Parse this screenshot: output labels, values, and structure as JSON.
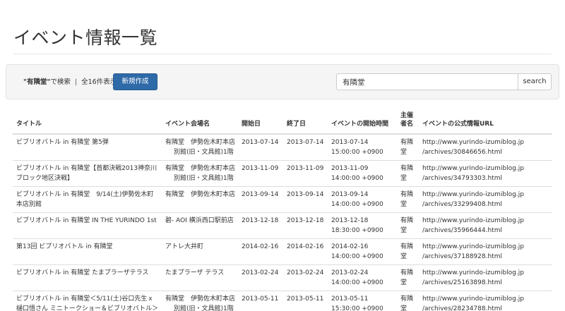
{
  "page": {
    "title": "イベント情報一覧"
  },
  "search_bar": {
    "query_display": "\"有隣堂\"",
    "query_suffix": "で検索",
    "separator": "|",
    "count_text": "全16件表示",
    "new_button_label": "新規作成",
    "input_value": "有隣堂",
    "search_button_label": "search"
  },
  "table": {
    "headers": {
      "title": "タイトル",
      "venue": "イベント会場名",
      "start_date": "開始日",
      "end_date": "終了日",
      "start_time": "イベントの開始時間",
      "organizer": "主催者名",
      "url": "イベントの公式情報URL"
    },
    "rows": [
      {
        "title": "ビブリオバトル in 有隣堂 第5弾",
        "venue_line1": "有隣堂　伊勢佐木町本店",
        "venue_line2": "別館(旧・文具館)1階",
        "start_date": "2013-07-14",
        "end_date": "2013-07-14",
        "start_date2": "2013-07-14",
        "start_time": "15:00:00 +0900",
        "organizer": "有隣堂",
        "url_line1": "http://www.yurindo-izumiblog.jp",
        "url_line2": "/archives/30846656.html"
      },
      {
        "title": "ビブリオバトル in 有隣堂【首都決戦2013神奈川ブロック地区決戦】",
        "venue_line1": "有隣堂　伊勢佐木町本店",
        "venue_line2": "別館(旧・文具館)1階",
        "start_date": "2013-11-09",
        "end_date": "2013-11-09",
        "start_date2": "2013-11-09",
        "start_time": "14:00:00 +0900",
        "organizer": "有隣堂",
        "url_line1": "http://www.yurindo-izumiblog.jp",
        "url_line2": "/archives/34793303.html"
      },
      {
        "title": "ビブリオバトル in 有隣堂　9/14(土)伊勢佐木町本店別館",
        "venue_line1": "有隣堂　伊勢佐木町本店",
        "venue_line2": "",
        "start_date": "2013-09-14",
        "end_date": "2013-09-14",
        "start_date2": "2013-09-14",
        "start_time": "14:00:00 +0900",
        "organizer": "有隣堂",
        "url_line1": "http://www.yurindo-izumiblog.jp",
        "url_line2": "/archives/33299408.html"
      },
      {
        "title": "ビブリオバトル in 有隣堂 IN THE YURINDO 1st",
        "venue_line1": "碧- AOI 横浜西口駅前店",
        "venue_line2": "",
        "start_date": "2013-12-18",
        "end_date": "2013-12-18",
        "start_date2": "2013-12-18",
        "start_time": "18:30:00 +0900",
        "organizer": "有隣堂",
        "url_line1": "http://www.yurindo-izumiblog.jp",
        "url_line2": "/archives/35966444.html"
      },
      {
        "title": "第13回 ビブリオバトル in 有隣堂",
        "venue_line1": "アトレ大井町",
        "venue_line2": "",
        "start_date": "2014-02-16",
        "end_date": "2014-02-16",
        "start_date2": "2014-02-16",
        "start_time": "14:00:00 +0900",
        "organizer": "有隣堂",
        "url_line1": "http://www.yurindo-izumiblog.jp",
        "url_line2": "/archives/37188928.html"
      },
      {
        "title": "ビブリオバトル in 有隣堂 たまプラーザテラス",
        "venue_line1": "たまプラーザ テラス",
        "venue_line2": "",
        "start_date": "2013-02-24",
        "end_date": "2013-02-24",
        "start_date2": "2013-02-24",
        "start_time": "14:00:00 +0900",
        "organizer": "有隣堂",
        "url_line1": "http://www.yurindo-izumiblog.jp",
        "url_line2": "/archives/25163898.html"
      },
      {
        "title": "ビブリオバトル in 有隣堂＜5/11(土)谷口先生ｘ樋口悟さん ミニトークショー＆ビブリオバトル＞",
        "venue_line1": "有隣堂　伊勢佐木町本店",
        "venue_line2": "別館(旧・文具館)1階",
        "start_date": "2013-05-11",
        "end_date": "2013-05-11",
        "start_date2": "2013-05-11",
        "start_time": "15:30:00 +0900",
        "organizer": "有隣堂",
        "url_line1": "http://www.yurindo-izumiblog.jp",
        "url_line2": "/archives/28234788.html"
      }
    ]
  }
}
